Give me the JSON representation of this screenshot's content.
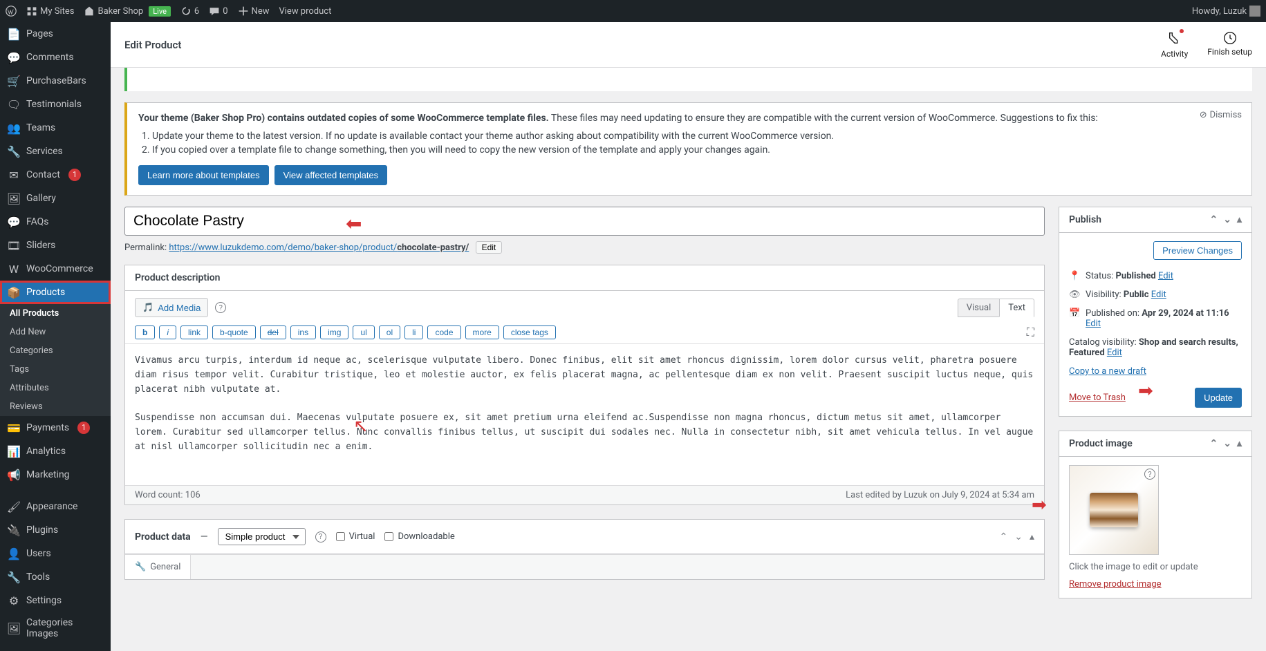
{
  "adminBar": {
    "mySites": "My Sites",
    "siteName": "Baker Shop",
    "liveBadge": "Live",
    "updateCount": "6",
    "commentCount": "0",
    "new": "New",
    "viewProduct": "View product",
    "howdy": "Howdy, Luzuk"
  },
  "sidebar": {
    "pages": "Pages",
    "comments": "Comments",
    "purchaseBars": "PurchaseBars",
    "testimonials": "Testimonials",
    "teams": "Teams",
    "services": "Services",
    "contact": "Contact",
    "contactBadge": "1",
    "gallery": "Gallery",
    "faqs": "FAQs",
    "sliders": "Sliders",
    "woocommerce": "WooCommerce",
    "products": "Products",
    "submenu": {
      "allProducts": "All Products",
      "addNew": "Add New",
      "categories": "Categories",
      "tags": "Tags",
      "attributes": "Attributes",
      "reviews": "Reviews"
    },
    "payments": "Payments",
    "paymentsBadge": "1",
    "analytics": "Analytics",
    "marketing": "Marketing",
    "appearance": "Appearance",
    "plugins": "Plugins",
    "users": "Users",
    "tools": "Tools",
    "settings": "Settings",
    "categoriesImages": "Categories Images"
  },
  "header": {
    "title": "Edit Product",
    "activity": "Activity",
    "finishSetup": "Finish setup"
  },
  "notice": {
    "strong": "Your theme (Baker Shop Pro) contains outdated copies of some WooCommerce template files.",
    "rest": " These files may need updating to ensure they are compatible with the current version of WooCommerce. Suggestions to fix this:",
    "li1": "Update your theme to the latest version. If no update is available contact your theme author asking about compatibility with the current WooCommerce version.",
    "li2": "If you copied over a template file to change something, then you will need to copy the new version of the template and apply your changes again.",
    "learnMore": "Learn more about templates",
    "viewAffected": "View affected templates",
    "dismiss": "Dismiss"
  },
  "product": {
    "title": "Chocolate Pastry",
    "permalinkLabel": "Permalink: ",
    "permalinkBase": "https://www.luzukdemo.com/demo/baker-shop/product/",
    "permalinkSlug": "chocolate-pastry/",
    "editSlug": "Edit"
  },
  "editor": {
    "panelTitle": "Product description",
    "addMedia": "Add Media",
    "tabVisual": "Visual",
    "tabText": "Text",
    "tags": {
      "b": "b",
      "i": "i",
      "link": "link",
      "bquote": "b-quote",
      "del": "del",
      "ins": "ins",
      "img": "img",
      "ul": "ul",
      "ol": "ol",
      "li": "li",
      "code": "code",
      "more": "more",
      "close": "close tags"
    },
    "content": "Vivamus arcu turpis, interdum id neque ac, scelerisque vulputate libero. Donec finibus, elit sit amet rhoncus dignissim, lorem dolor cursus velit, pharetra posuere diam risus tempor velit. Curabitur tristique, leo et molestie auctor, ex felis placerat magna, ac pellentesque diam ex non velit. Praesent suscipit luctus neque, quis placerat nibh vulputate at.\n\nSuspendisse non accumsan dui. Maecenas vulputate posuere ex, sit amet pretium urna eleifend ac.Suspendisse non magna rhoncus, dictum metus sit amet, ullamcorper lorem. Curabitur sed ullamcorper tellus. Nunc convallis finibus tellus, ut suscipit dui sodales nec. Nulla in consectetur nibh, sit amet vehicula tellus. In vel augue at nisl ullamcorper sollicitudin nec a enim.",
    "wordCount": "Word count: 106",
    "lastEdited": "Last edited by Luzuk on July 9, 2024 at 5:34 am"
  },
  "productData": {
    "label": "Product data",
    "dash": "—",
    "selected": "Simple product",
    "virtual": "Virtual",
    "downloadable": "Downloadable",
    "tabGeneral": "General"
  },
  "publish": {
    "title": "Publish",
    "previewChanges": "Preview Changes",
    "statusLabel": "Status: ",
    "statusValue": "Published",
    "visibilityLabel": "Visibility: ",
    "visibilityValue": "Public",
    "publishedLabel": "Published on: ",
    "publishedValue": "Apr 29, 2024 at 11:16",
    "catalogLabel": "Catalog visibility: ",
    "catalogValue": "Shop and search results, Featured",
    "editLink": "Edit",
    "copyDraft": "Copy to a new draft",
    "moveTrash": "Move to Trash",
    "update": "Update"
  },
  "productImage": {
    "title": "Product image",
    "hint": "Click the image to edit or update",
    "remove": "Remove product image"
  }
}
